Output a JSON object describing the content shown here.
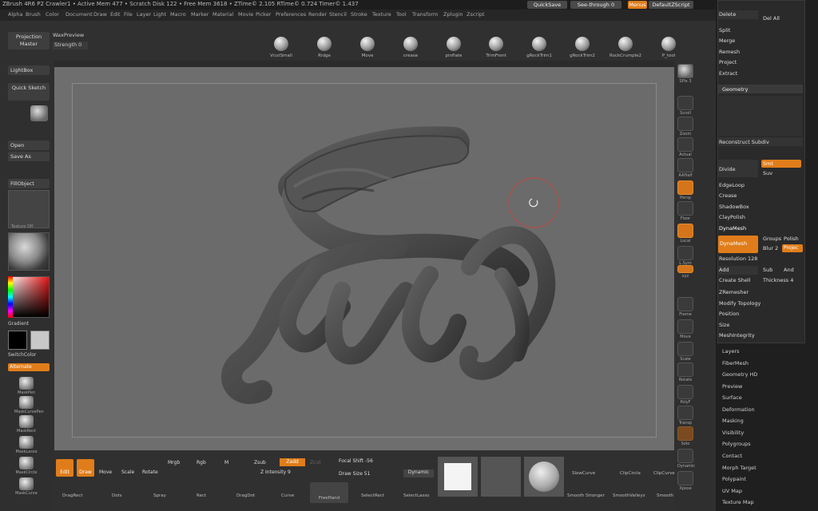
{
  "titlebar": {
    "text": "ZBrush 4R6 P2    Crawler1    • Active Mem 477 • Scratch Disk 122 • Free Mem 3618 • ZTime© 2.105 RTime© 0.724 Timer© 1.437",
    "quicksave": "QuickSave",
    "see_through": "See-through  0",
    "menus": "Menus",
    "script": "DefaultZScript"
  },
  "menubar": [
    "Alpha",
    "Brush",
    "Color",
    "Document",
    "Draw",
    "Edit",
    "File",
    "Layer",
    "Light",
    "Macro",
    "Marker",
    "Material",
    "Movie",
    "Picker",
    "Preferences",
    "Render",
    "Stencil",
    "Stroke",
    "Texture",
    "Tool",
    "Transform",
    "Zplugin",
    "Zscript"
  ],
  "topshelf": {
    "projection_master": "Projection Master",
    "wax_preview": "WaxPreview",
    "strength": "Strength 0",
    "brushes": [
      "VcutSmall",
      "Ridge",
      "Move",
      "crease",
      "pinflate",
      "TrimFront",
      "gRockTrim1",
      "gRockTrim2",
      "RockCrumple2",
      "P_tool"
    ]
  },
  "leftshelf": {
    "lightbox": "LightBox",
    "quick_sketch": "Quick Sketch",
    "open": "Open",
    "save_as": "Save As",
    "fill_object": "FillObject",
    "texture_off": "Texture Off",
    "gradient": "Gradient",
    "switch_color": "SwitchColor",
    "alternate": "Alternate",
    "tools": [
      "MaskPen",
      "MaskCurvePen",
      "MaskRect",
      "MaskLasso",
      "MaskCircle",
      "MaskCurve"
    ]
  },
  "righttools": [
    "SPix 3",
    "Scroll",
    "Zoom",
    "Actual",
    "AAHalf",
    "Persp",
    "Floor",
    "Local",
    "L.Sym",
    "xyz",
    "Frame",
    "Move",
    "Scale",
    "Rotate",
    "PolyF",
    "Transp",
    "Solo",
    "Dynamic",
    "Xpose"
  ],
  "tray": {
    "delete": "Delete",
    "del_all": "Del All",
    "split": "Split",
    "merge": "Merge",
    "remesh": "Remesh",
    "project": "Project",
    "extract": "Extract",
    "geometry": "Geometry",
    "reconstruct_subdiv": "Reconstruct Subdiv",
    "divide": "Divide",
    "smt": "Smt",
    "suv": "Suv",
    "edgeloop": "EdgeLoop",
    "crease": "Crease",
    "shadowbox": "ShadowBox",
    "claypolish": "ClayPolish",
    "dynamesh": "DynaMesh",
    "dynamesh_btn": "DynaMesh",
    "groups": "Groups",
    "polish": "Polish",
    "blur": "Blur 2",
    "projec": "Projec",
    "resolution": "Resolution 128",
    "add": "Add",
    "sub": "Sub",
    "and": "And",
    "create_shell": "Create Shell",
    "thickness": "Thickness 4",
    "zremesher": "ZRemesher",
    "modify_topology": "Modify Topology",
    "position": "Position",
    "size": "Size",
    "meshintegrity": "MeshIntegrity",
    "submenus": [
      "Layers",
      "FiberMesh",
      "Geometry HD",
      "Preview",
      "Surface",
      "Deformation",
      "Masking",
      "Visibility",
      "Polygroups",
      "Contact",
      "Morph Target",
      "Polypaint",
      "UV Map",
      "Texture Map"
    ]
  },
  "bottomshelf": {
    "edit": "Edit",
    "draw": "Draw",
    "move": "Move",
    "scale": "Scale",
    "rotate": "Rotate",
    "mrgb": "Mrgb",
    "rgb": "Rgb",
    "m": "M",
    "zsub": "Zsub",
    "zadd": "Zadd",
    "zcut": "Zcut",
    "focal_shift": "Focal Shift -56",
    "z_intensity": "Z Intensity 9",
    "draw_size": "Draw Size 51",
    "dynamic": "Dynamic",
    "strokes": [
      "DragRect",
      "Dots",
      "Spray",
      "Rect",
      "DragDot",
      "Curve",
      "FreeHand",
      "SelectRect",
      "SelectLasso"
    ],
    "swatch_labels": [
      "SlowCurve",
      "ClipCircle",
      "ClipCurve",
      "Smooth Stronger",
      "SmoothValleys",
      "Smooth"
    ]
  }
}
